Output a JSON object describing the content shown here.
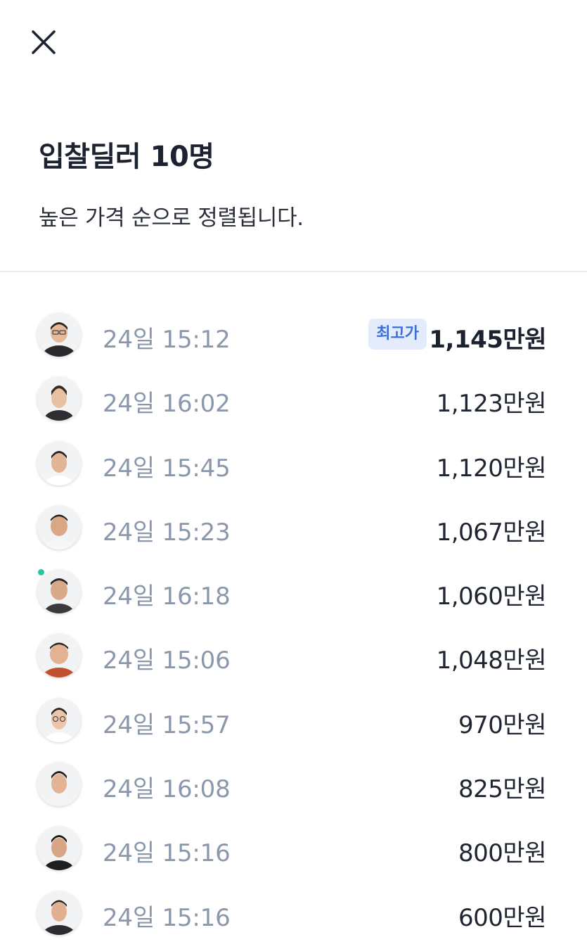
{
  "header": {
    "title": "입찰딜러 10명",
    "subtitle": "높은 가격 순으로 정렬됩니다."
  },
  "colors": {
    "accent": "#3f6fd6",
    "badge_bg": "#e4ecfc",
    "time_text": "#8b98ab",
    "online": "#2ec4a0"
  },
  "bids": [
    {
      "time": "24일 15:12",
      "price": "1,145만원",
      "badge": "최고가"
    },
    {
      "time": "24일 16:02",
      "price": "1,123만원"
    },
    {
      "time": "24일 15:45",
      "price": "1,120만원"
    },
    {
      "time": "24일 15:23",
      "price": "1,067만원"
    },
    {
      "time": "24일 16:18",
      "price": "1,060만원",
      "online": true
    },
    {
      "time": "24일 15:06",
      "price": "1,048만원"
    },
    {
      "time": "24일 15:57",
      "price": "970만원"
    },
    {
      "time": "24일 16:08",
      "price": "825만원"
    },
    {
      "time": "24일 15:16",
      "price": "800만원"
    },
    {
      "time": "24일 15:16",
      "price": "600만원"
    }
  ]
}
